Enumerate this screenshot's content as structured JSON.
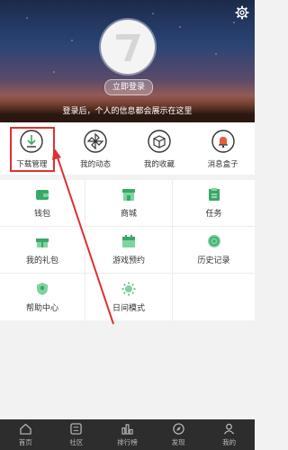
{
  "header": {
    "login_button": "立即登录",
    "login_hint": "登录后，个人的信息都会展示在这里"
  },
  "quick_actions": [
    {
      "label": "下载管理",
      "icon": "download-icon"
    },
    {
      "label": "我的动态",
      "icon": "pinwheel-icon"
    },
    {
      "label": "我的收藏",
      "icon": "box-icon"
    },
    {
      "label": "消息盒子",
      "icon": "bell-icon"
    }
  ],
  "grid": [
    {
      "label": "钱包",
      "icon": "wallet-icon"
    },
    {
      "label": "商城",
      "icon": "shop-icon"
    },
    {
      "label": "任务",
      "icon": "clipboard-icon"
    },
    {
      "label": "我的礼包",
      "icon": "gift-icon"
    },
    {
      "label": "游戏预约",
      "icon": "calendar-icon"
    },
    {
      "label": "历史记录",
      "icon": "history-icon"
    },
    {
      "label": "帮助中心",
      "icon": "shield-icon"
    },
    {
      "label": "日间模式",
      "icon": "sun-icon"
    }
  ],
  "nav": [
    {
      "label": "首页",
      "icon": "home-icon"
    },
    {
      "label": "社区",
      "icon": "community-icon"
    },
    {
      "label": "排行榜",
      "icon": "ranking-icon"
    },
    {
      "label": "发现",
      "icon": "discover-icon"
    },
    {
      "label": "我的",
      "icon": "profile-icon"
    }
  ],
  "colors": {
    "accent": "#3aa868",
    "highlight": "#e03030"
  }
}
